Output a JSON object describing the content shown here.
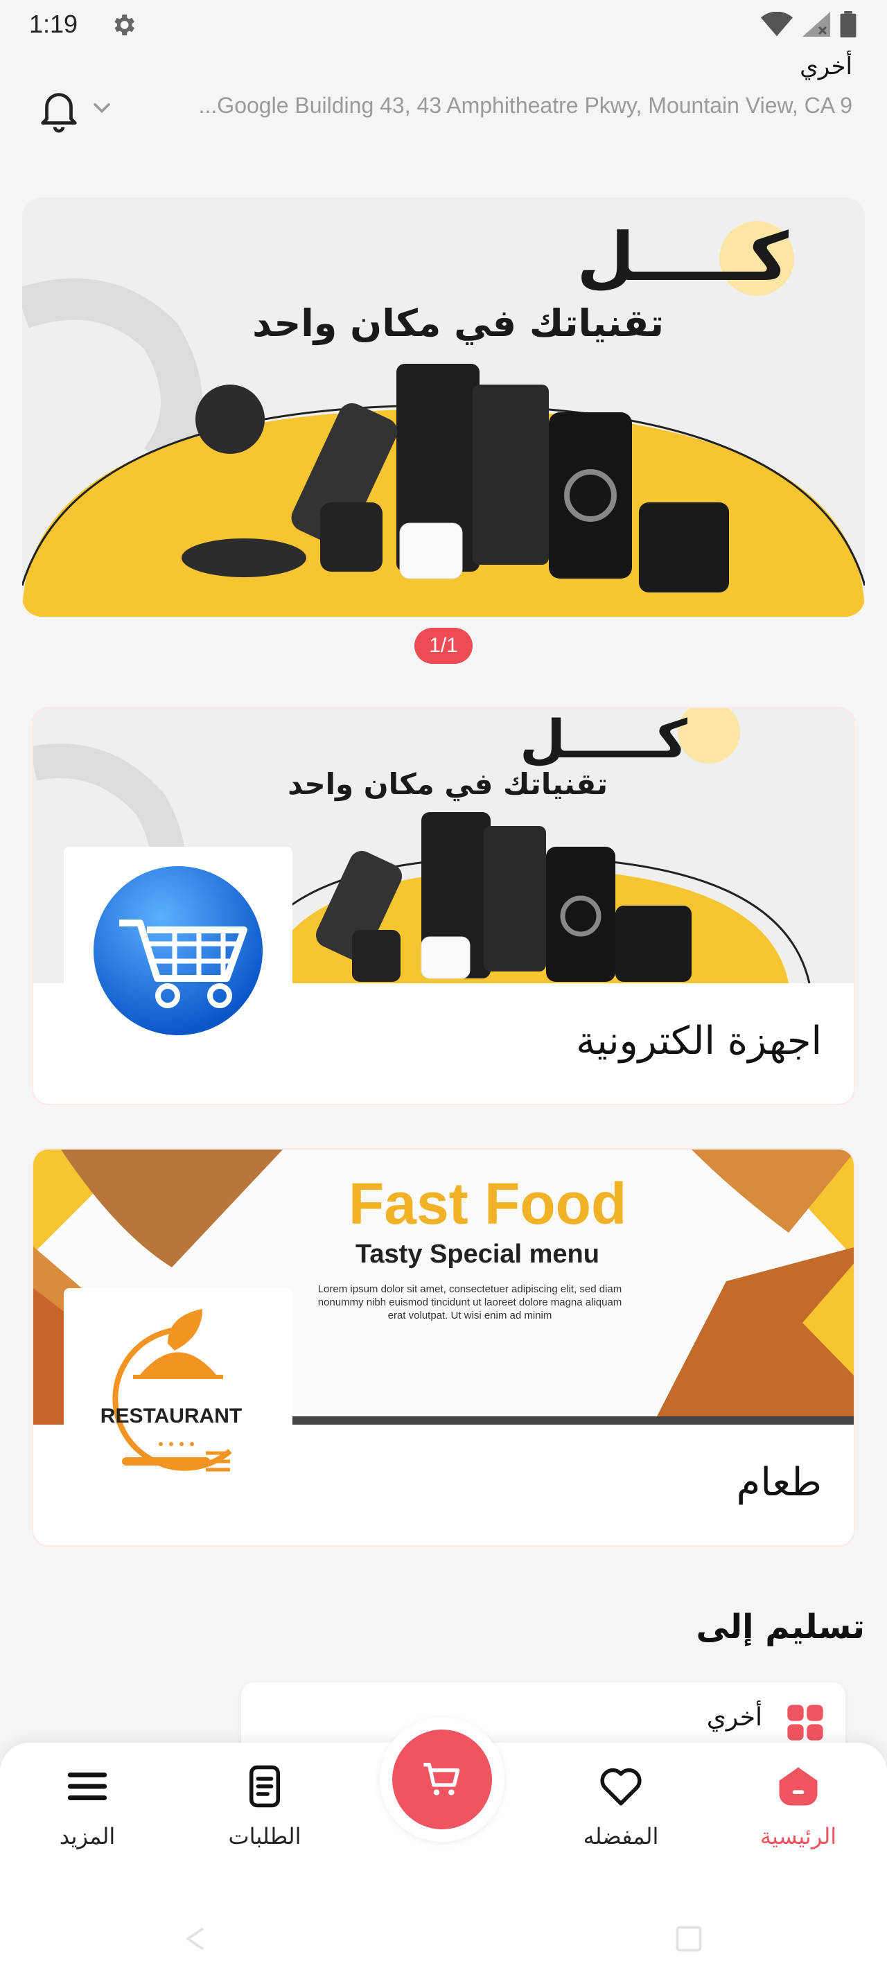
{
  "status_bar": {
    "time": "1:19"
  },
  "header": {
    "address_label": "أخري",
    "address_line": "...Google Building 43, 43 Amphitheatre Pkwy, Mountain View, CA 9"
  },
  "banner": {
    "headline": "كـــــل",
    "subtitle": "تقنياتك في مكان واحد",
    "counter": "1/1"
  },
  "categories": [
    {
      "title": "اجهزة الكترونية",
      "banner_headline": "كـــــل",
      "banner_subtitle": "تقنياتك في مكان واحد",
      "logo_icon": "shopping-cart-icon"
    },
    {
      "title": "طعام",
      "banner_headline": "Fast Food",
      "banner_subtitle": "Tasty Special menu",
      "banner_text": "Lorem ipsum dolor sit amet, consectetuer adipiscing elit, sed diam nonummy nibh euismod tincidunt ut laoreet dolore magna aliquam erat volutpat. Ut wisi enim ad minim",
      "logo_text": "RESTAURANT",
      "logo_icon": "restaurant-cloche-icon"
    }
  ],
  "delivery": {
    "section_title": "تسليم إلى",
    "item_label": "أخري",
    "item_icon": "grid-icon"
  },
  "bottom_nav": {
    "home": "الرئيسية",
    "favorites": "المفضله",
    "orders": "الطلبات",
    "more": "المزيد",
    "cart_icon": "cart-icon"
  },
  "colors": {
    "accent": "#ef5561",
    "banner_yellow": "#f7c531",
    "food_orange": "#f29422"
  }
}
